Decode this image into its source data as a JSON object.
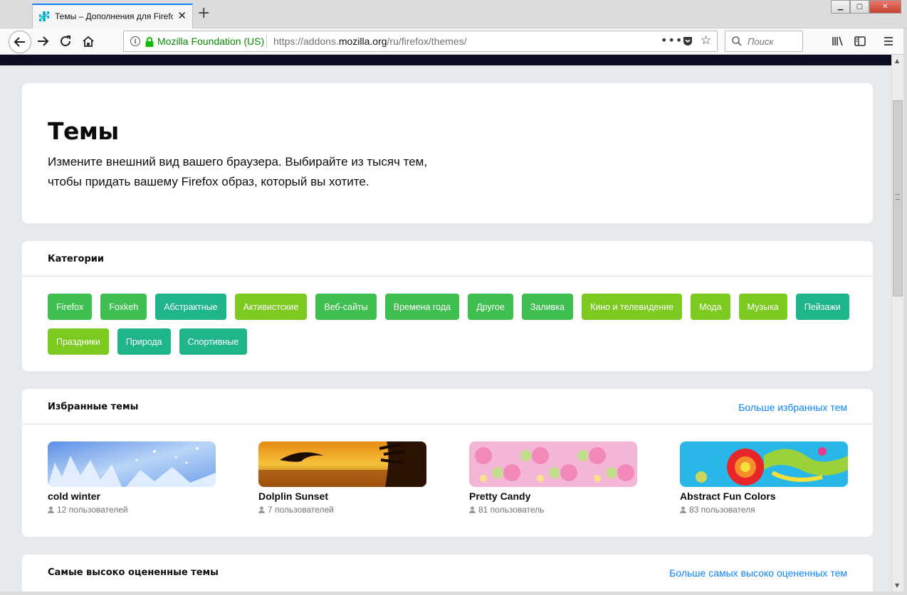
{
  "browser": {
    "tab_title": "Темы – Дополнения для Firefox",
    "identity": "Mozilla Foundation (US)",
    "url_prefix": "https://addons.",
    "url_domain": "mozilla.org",
    "url_path": "/ru/firefox/themes/",
    "search_placeholder": "Поиск"
  },
  "hero": {
    "title": "Темы",
    "line1": "Измените внешний вид вашего браузера. Выбирайте из тысяч тем,",
    "line2": "чтобы придать вашему Firefox образ, который вы хотите."
  },
  "categories": {
    "title": "Категории",
    "items": [
      {
        "label": "Firefox",
        "color": "#3fbf50"
      },
      {
        "label": "Foxkeh",
        "color": "#3fbf50"
      },
      {
        "label": "Абстрактные",
        "color": "#1fb58a"
      },
      {
        "label": "Активистские",
        "color": "#7cc91f"
      },
      {
        "label": "Веб-сайты",
        "color": "#3fbf50"
      },
      {
        "label": "Времена года",
        "color": "#3fbf50"
      },
      {
        "label": "Другое",
        "color": "#3fbf50"
      },
      {
        "label": "Заливка",
        "color": "#3fbf50"
      },
      {
        "label": "Кино и телевидение",
        "color": "#7cc91f"
      },
      {
        "label": "Мода",
        "color": "#7cc91f"
      },
      {
        "label": "Музыка",
        "color": "#7cc91f"
      },
      {
        "label": "Пейзажи",
        "color": "#1fb58a"
      },
      {
        "label": "Праздники",
        "color": "#7cc91f"
      },
      {
        "label": "Природа",
        "color": "#1fb58a"
      },
      {
        "label": "Спортивные",
        "color": "#1fb58a"
      }
    ]
  },
  "featured": {
    "title": "Избранные темы",
    "more_link": "Больше избранных тем",
    "themes": [
      {
        "name": "cold winter",
        "users": "12 пользователей"
      },
      {
        "name": "Dolplin Sunset",
        "users": "7 пользователей"
      },
      {
        "name": "Pretty Candy",
        "users": "81 пользователь"
      },
      {
        "name": "Abstract Fun Colors",
        "users": "83 пользователя"
      }
    ]
  },
  "toprated": {
    "title": "Самые высоко оцененные темы",
    "more_link": "Больше самых высоко оцененных тем"
  },
  "colors": {
    "accent": "#0a84ff",
    "green": "#3fbf50",
    "lime": "#7cc91f",
    "teal": "#1fb58a",
    "secure": "#058b00"
  }
}
